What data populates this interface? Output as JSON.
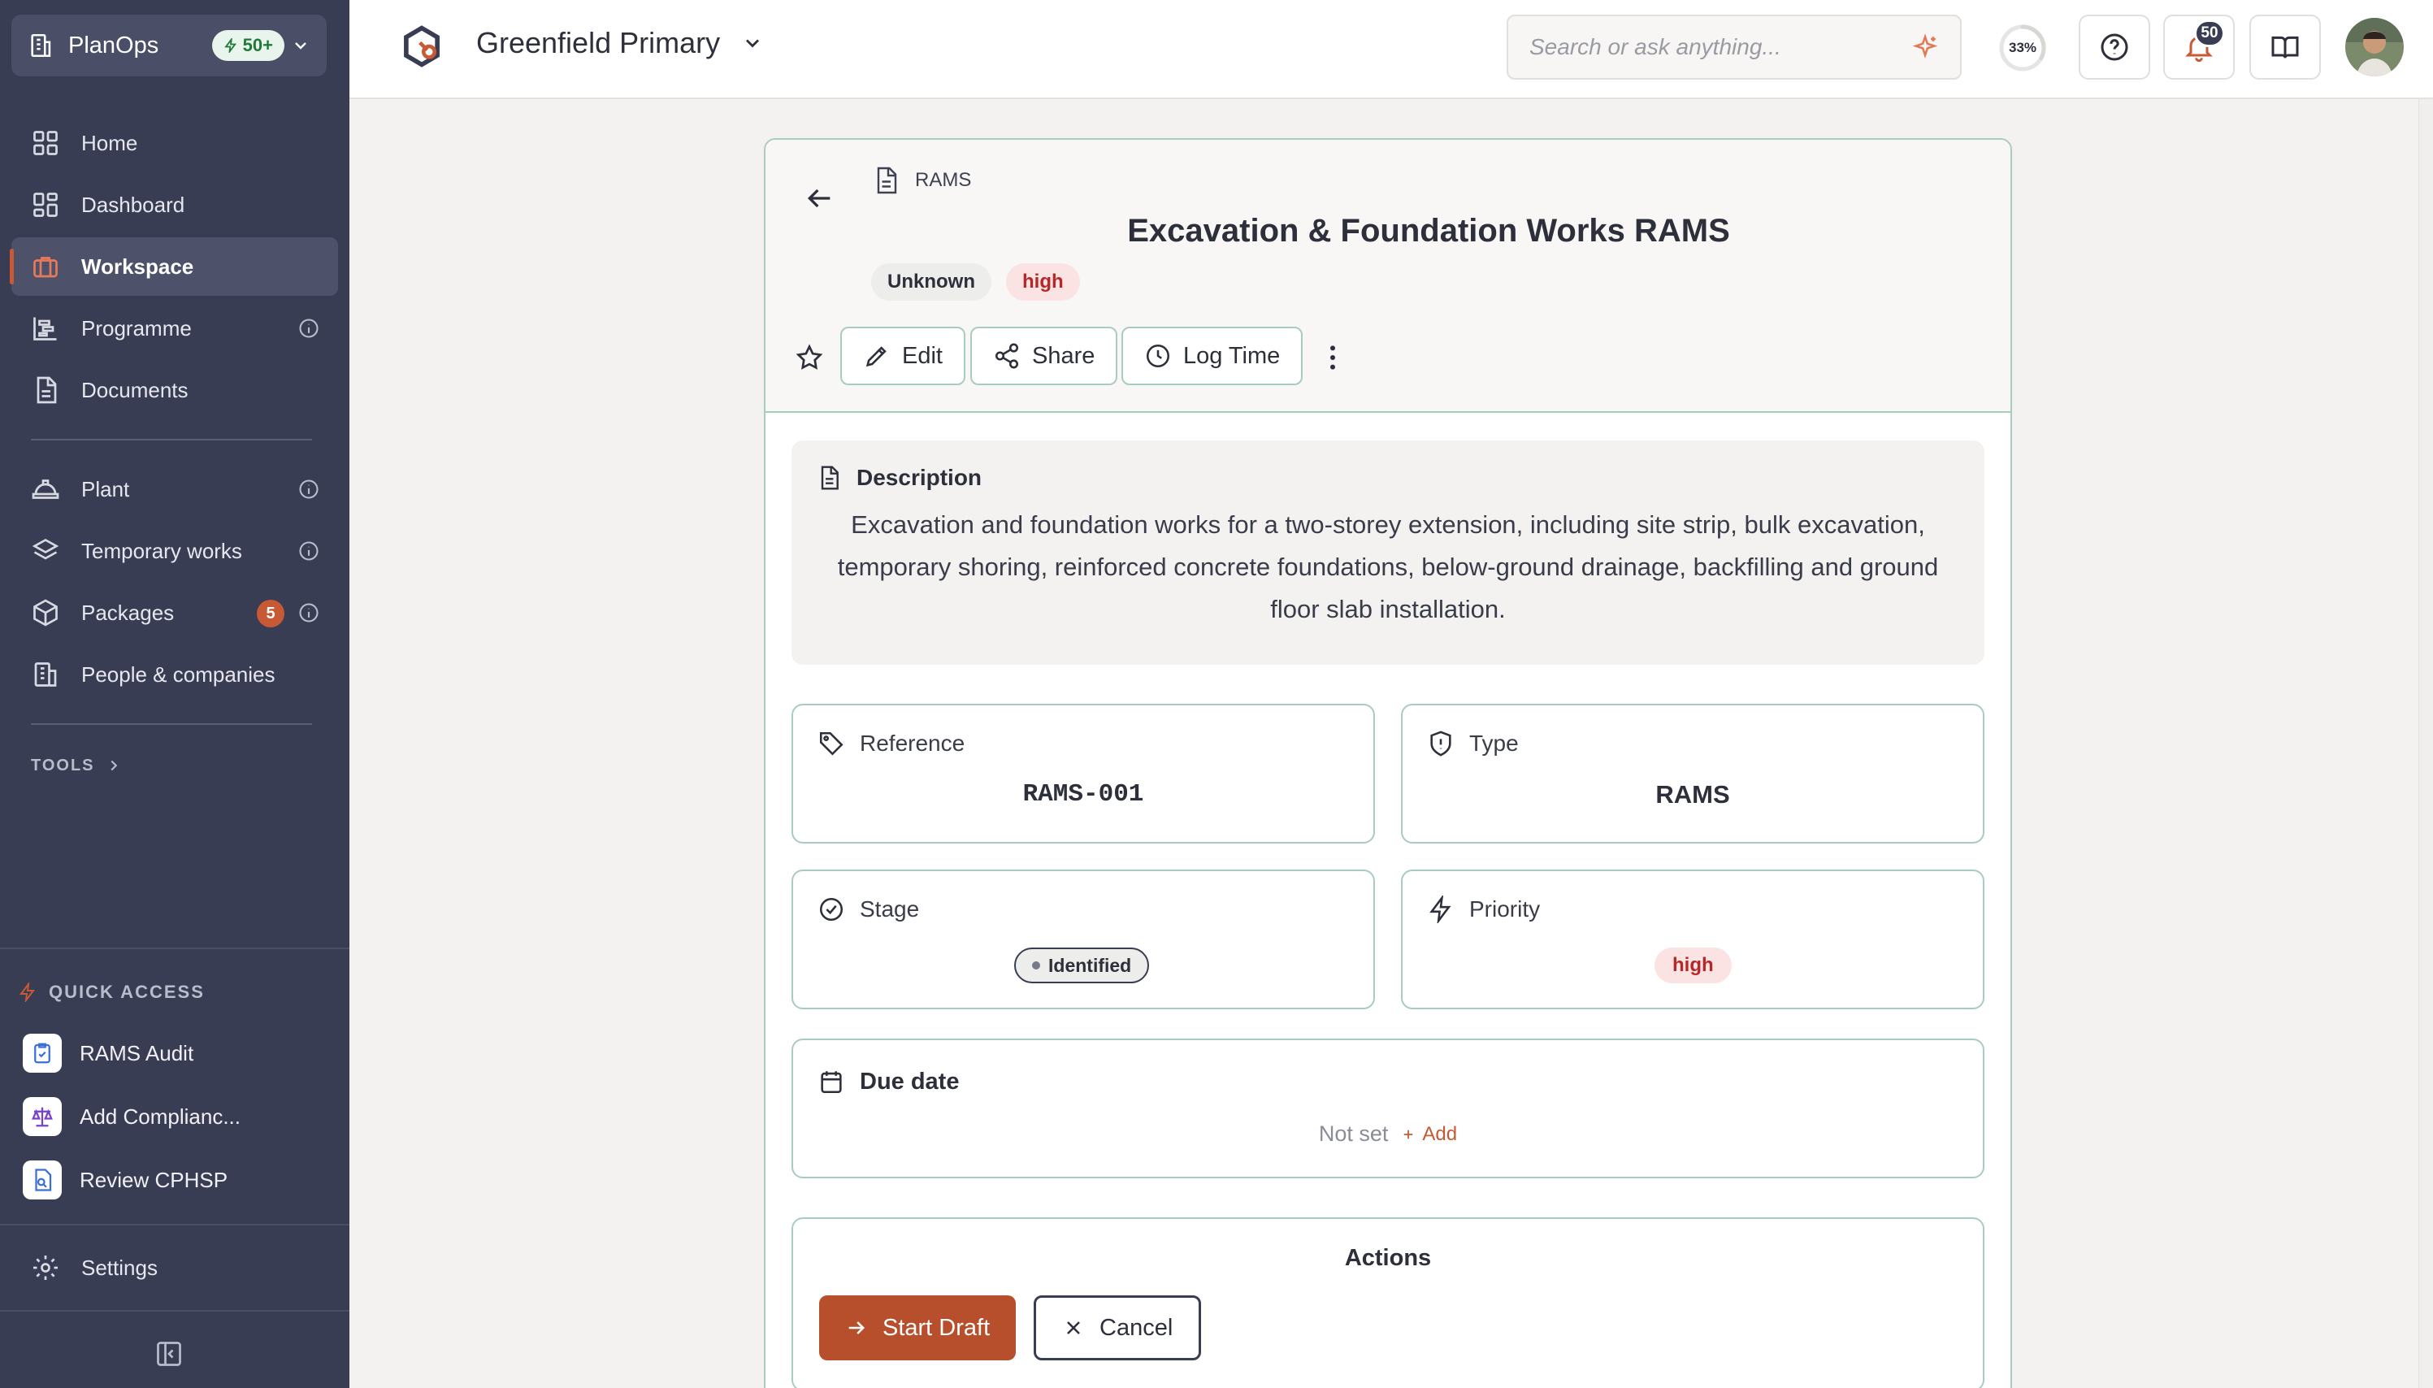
{
  "org": {
    "name": "PlanOps",
    "badge": "50+"
  },
  "nav": {
    "items": [
      {
        "label": "Home",
        "icon": "grid-icon"
      },
      {
        "label": "Dashboard",
        "icon": "dashboard-icon"
      },
      {
        "label": "Workspace",
        "icon": "briefcase-icon",
        "active": true
      },
      {
        "label": "Programme",
        "icon": "gantt-icon"
      },
      {
        "label": "Documents",
        "icon": "document-icon"
      },
      {
        "label": "Plant",
        "icon": "hardhat-icon"
      },
      {
        "label": "Temporary works",
        "icon": "layers-icon"
      },
      {
        "label": "Packages",
        "icon": "package-icon",
        "count": "5"
      },
      {
        "label": "People & companies",
        "icon": "building-icon"
      }
    ],
    "tools_label": "TOOLS"
  },
  "quick_access": {
    "title": "QUICK ACCESS",
    "items": [
      {
        "label": "RAMS Audit"
      },
      {
        "label": "Add Complianc..."
      },
      {
        "label": "Review CPHSP"
      }
    ]
  },
  "settings_label": "Settings",
  "topbar": {
    "project": "Greenfield Primary",
    "search_placeholder": "Search or ask anything...",
    "progress": "33%",
    "progress_value": 0.33,
    "notifications": "50"
  },
  "record": {
    "breadcrumb": "RAMS",
    "title": "Excavation & Foundation Works RAMS",
    "tags": [
      "Unknown",
      "high"
    ],
    "buttons": {
      "edit": "Edit",
      "share": "Share",
      "log_time": "Log Time"
    },
    "description": {
      "label": "Description",
      "text": "Excavation and foundation works for a two-storey extension, including site strip, bulk excavation, temporary shoring, reinforced concrete foundations, below-ground drainage, backfilling and ground floor slab installation."
    },
    "reference": {
      "label": "Reference",
      "value": "RAMS-001"
    },
    "type": {
      "label": "Type",
      "value": "RAMS"
    },
    "stage": {
      "label": "Stage",
      "value": "Identified"
    },
    "priority": {
      "label": "Priority",
      "value": "high"
    },
    "due_date": {
      "label": "Due date",
      "value": "Not set",
      "add": "Add"
    },
    "actions": {
      "title": "Actions",
      "start": "Start Draft",
      "cancel": "Cancel"
    }
  },
  "colors": {
    "sidebar": "#393d53",
    "accent": "#c75a35",
    "border": "#a8ccc0",
    "high": "#b62828"
  }
}
